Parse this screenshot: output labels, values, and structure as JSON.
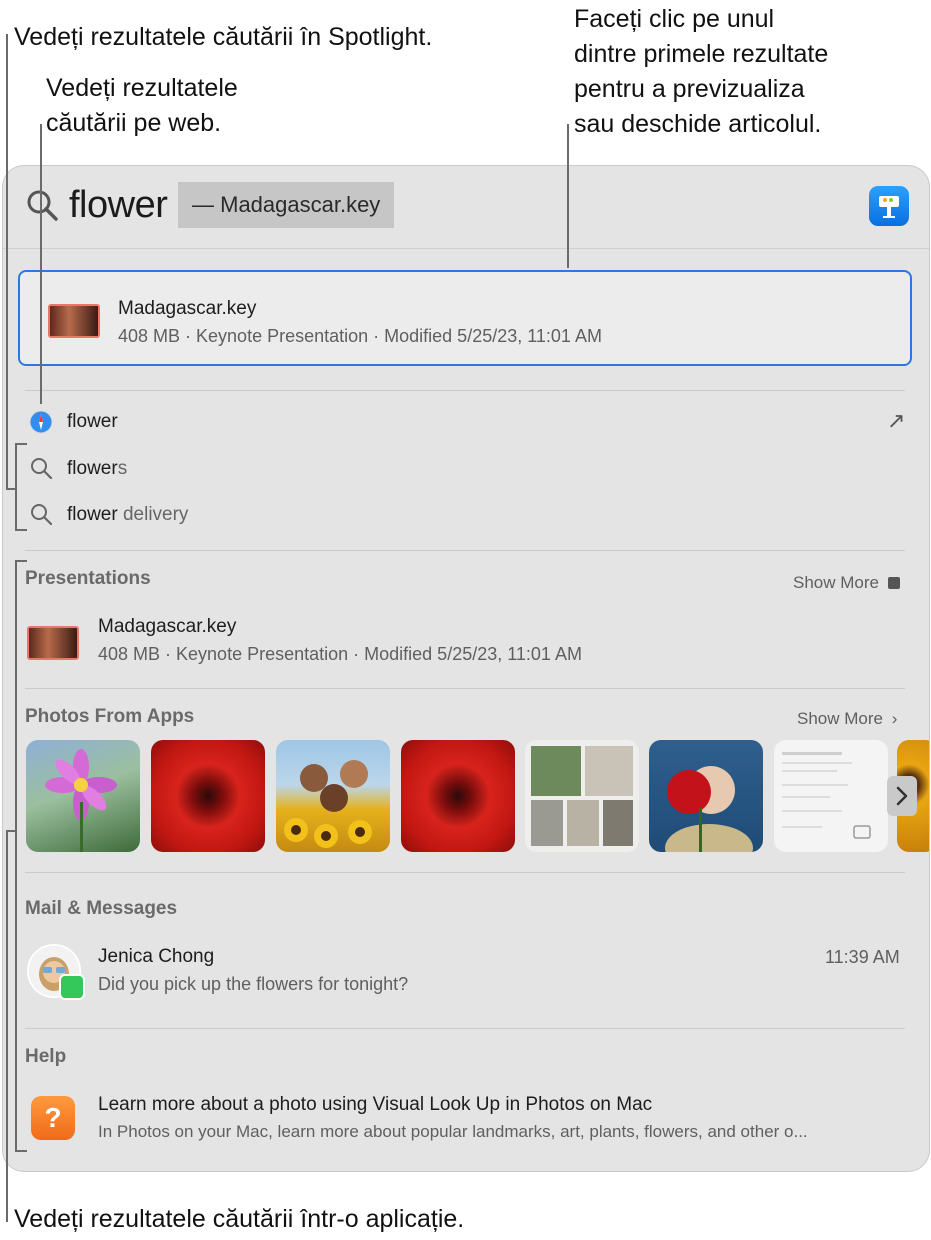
{
  "callouts": {
    "spotlight": "Vedeți rezultatele căutării în Spotlight.",
    "web_line1": "Vedeți rezultatele",
    "web_line2": "căutării pe web.",
    "top_line1": "Faceți clic pe unul",
    "top_line2": "dintre primele rezultate",
    "top_line3": "pentru a previzualiza",
    "top_line4": "sau deschide articolul.",
    "app": "Vedeți rezultatele căutării într-o aplicație."
  },
  "search": {
    "query": "flower",
    "completion": "— Madagascar.key"
  },
  "top_hit": {
    "title": "Madagascar.key",
    "details": "408 MB · Keynote Presentation · Modified 5/25/23, 11:01 AM"
  },
  "suggestions": [
    {
      "bold": "flower",
      "rest": "",
      "icon": "safari-icon",
      "arrow": "↗"
    },
    {
      "bold": "flower",
      "rest": "s",
      "icon": "search-icon"
    },
    {
      "bold": "flower",
      "rest": " delivery",
      "icon": "search-icon"
    }
  ],
  "presentations": {
    "header": "Presentations",
    "show_more": "Show More",
    "item_title": "Madagascar.key",
    "item_details": "408 MB · Keynote Presentation · Modified 5/25/23, 11:01 AM"
  },
  "photos": {
    "header": "Photos From Apps",
    "show_more": "Show More"
  },
  "mail": {
    "header": "Mail & Messages",
    "sender": "Jenica Chong",
    "time": "11:39 AM",
    "preview": "Did you pick up the flowers for tonight?"
  },
  "help": {
    "header": "Help",
    "title": "Learn more about a photo using Visual Look Up in Photos on Mac",
    "details": "In Photos on your Mac, learn more about popular landmarks, art, plants, flowers, and other o..."
  }
}
